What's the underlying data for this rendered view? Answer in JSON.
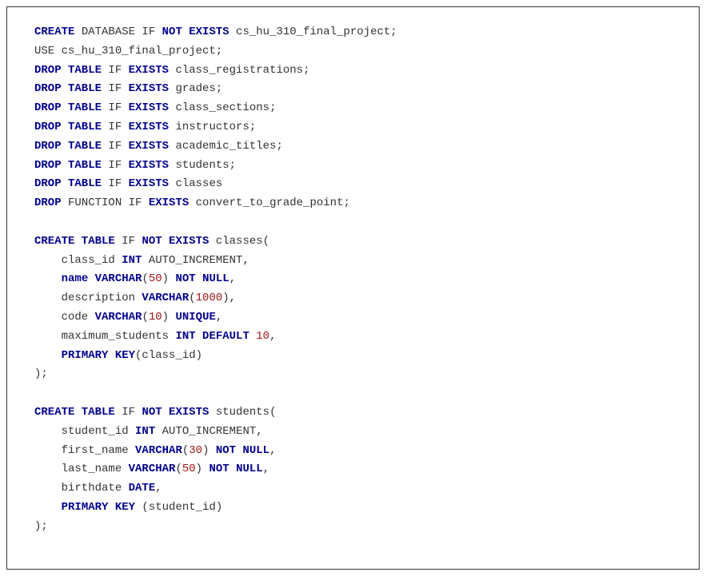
{
  "code": {
    "lines": [
      [
        {
          "t": "CREATE",
          "c": "kw"
        },
        {
          "t": " DATABASE IF ",
          "c": "plain"
        },
        {
          "t": "NOT EXISTS",
          "c": "kw"
        },
        {
          "t": " cs_hu_310_final_project;",
          "c": "plain"
        }
      ],
      [
        {
          "t": "USE cs_hu_310_final_project;",
          "c": "plain"
        }
      ],
      [
        {
          "t": "DROP TABLE",
          "c": "kw"
        },
        {
          "t": " IF ",
          "c": "plain"
        },
        {
          "t": "EXISTS",
          "c": "kw"
        },
        {
          "t": " class_registrations;",
          "c": "plain"
        }
      ],
      [
        {
          "t": "DROP TABLE",
          "c": "kw"
        },
        {
          "t": " IF ",
          "c": "plain"
        },
        {
          "t": "EXISTS",
          "c": "kw"
        },
        {
          "t": " grades;",
          "c": "plain"
        }
      ],
      [
        {
          "t": "DROP TABLE",
          "c": "kw"
        },
        {
          "t": " IF ",
          "c": "plain"
        },
        {
          "t": "EXISTS",
          "c": "kw"
        },
        {
          "t": " class_sections;",
          "c": "plain"
        }
      ],
      [
        {
          "t": "DROP TABLE",
          "c": "kw"
        },
        {
          "t": " IF ",
          "c": "plain"
        },
        {
          "t": "EXISTS",
          "c": "kw"
        },
        {
          "t": " instructors;",
          "c": "plain"
        }
      ],
      [
        {
          "t": "DROP TABLE",
          "c": "kw"
        },
        {
          "t": " IF ",
          "c": "plain"
        },
        {
          "t": "EXISTS",
          "c": "kw"
        },
        {
          "t": " academic_titles;",
          "c": "plain"
        }
      ],
      [
        {
          "t": "DROP TABLE",
          "c": "kw"
        },
        {
          "t": " IF ",
          "c": "plain"
        },
        {
          "t": "EXISTS",
          "c": "kw"
        },
        {
          "t": " students;",
          "c": "plain"
        }
      ],
      [
        {
          "t": "DROP TABLE",
          "c": "kw"
        },
        {
          "t": " IF ",
          "c": "plain"
        },
        {
          "t": "EXISTS",
          "c": "kw"
        },
        {
          "t": " classes",
          "c": "plain"
        }
      ],
      [
        {
          "t": "DROP",
          "c": "kw"
        },
        {
          "t": " FUNCTION IF ",
          "c": "plain"
        },
        {
          "t": "EXISTS",
          "c": "kw"
        },
        {
          "t": " convert_to_grade_point;",
          "c": "plain"
        }
      ],
      [],
      [
        {
          "t": "CREATE TABLE",
          "c": "kw"
        },
        {
          "t": " IF ",
          "c": "plain"
        },
        {
          "t": "NOT EXISTS",
          "c": "kw"
        },
        {
          "t": " classes(",
          "c": "plain"
        }
      ],
      [
        {
          "t": "    class_id ",
          "c": "plain"
        },
        {
          "t": "INT",
          "c": "kw"
        },
        {
          "t": " AUTO_INCREMENT,",
          "c": "plain"
        }
      ],
      [
        {
          "t": "    ",
          "c": "plain"
        },
        {
          "t": "name VARCHAR",
          "c": "kw"
        },
        {
          "t": "(",
          "c": "plain"
        },
        {
          "t": "50",
          "c": "num"
        },
        {
          "t": ") ",
          "c": "plain"
        },
        {
          "t": "NOT NULL",
          "c": "kw"
        },
        {
          "t": ",",
          "c": "plain"
        }
      ],
      [
        {
          "t": "    description ",
          "c": "plain"
        },
        {
          "t": "VARCHAR",
          "c": "kw"
        },
        {
          "t": "(",
          "c": "plain"
        },
        {
          "t": "1000",
          "c": "num"
        },
        {
          "t": "),",
          "c": "plain"
        }
      ],
      [
        {
          "t": "    code ",
          "c": "plain"
        },
        {
          "t": "VARCHAR",
          "c": "kw"
        },
        {
          "t": "(",
          "c": "plain"
        },
        {
          "t": "10",
          "c": "num"
        },
        {
          "t": ") ",
          "c": "plain"
        },
        {
          "t": "UNIQUE",
          "c": "kw"
        },
        {
          "t": ",",
          "c": "plain"
        }
      ],
      [
        {
          "t": "    maximum_students ",
          "c": "plain"
        },
        {
          "t": "INT DEFAULT",
          "c": "kw"
        },
        {
          "t": " ",
          "c": "plain"
        },
        {
          "t": "10",
          "c": "num"
        },
        {
          "t": ",",
          "c": "plain"
        }
      ],
      [
        {
          "t": "    ",
          "c": "plain"
        },
        {
          "t": "PRIMARY KEY",
          "c": "kw"
        },
        {
          "t": "(class_id)",
          "c": "plain"
        }
      ],
      [
        {
          "t": ");",
          "c": "plain"
        }
      ],
      [],
      [
        {
          "t": "CREATE TABLE",
          "c": "kw"
        },
        {
          "t": " IF ",
          "c": "plain"
        },
        {
          "t": "NOT EXISTS",
          "c": "kw"
        },
        {
          "t": " students(",
          "c": "plain"
        }
      ],
      [
        {
          "t": "    student_id ",
          "c": "plain"
        },
        {
          "t": "INT",
          "c": "kw"
        },
        {
          "t": " AUTO_INCREMENT,",
          "c": "plain"
        }
      ],
      [
        {
          "t": "    first_name ",
          "c": "plain"
        },
        {
          "t": "VARCHAR",
          "c": "kw"
        },
        {
          "t": "(",
          "c": "plain"
        },
        {
          "t": "30",
          "c": "num"
        },
        {
          "t": ") ",
          "c": "plain"
        },
        {
          "t": "NOT NULL",
          "c": "kw"
        },
        {
          "t": ",",
          "c": "plain"
        }
      ],
      [
        {
          "t": "    last_name ",
          "c": "plain"
        },
        {
          "t": "VARCHAR",
          "c": "kw"
        },
        {
          "t": "(",
          "c": "plain"
        },
        {
          "t": "50",
          "c": "num"
        },
        {
          "t": ") ",
          "c": "plain"
        },
        {
          "t": "NOT NULL",
          "c": "kw"
        },
        {
          "t": ",",
          "c": "plain"
        }
      ],
      [
        {
          "t": "    birthdate ",
          "c": "plain"
        },
        {
          "t": "DATE",
          "c": "kw"
        },
        {
          "t": ",",
          "c": "plain"
        }
      ],
      [
        {
          "t": "    ",
          "c": "plain"
        },
        {
          "t": "PRIMARY KEY",
          "c": "kw"
        },
        {
          "t": " (student_id)",
          "c": "plain"
        }
      ],
      [
        {
          "t": ");",
          "c": "plain"
        }
      ]
    ]
  }
}
